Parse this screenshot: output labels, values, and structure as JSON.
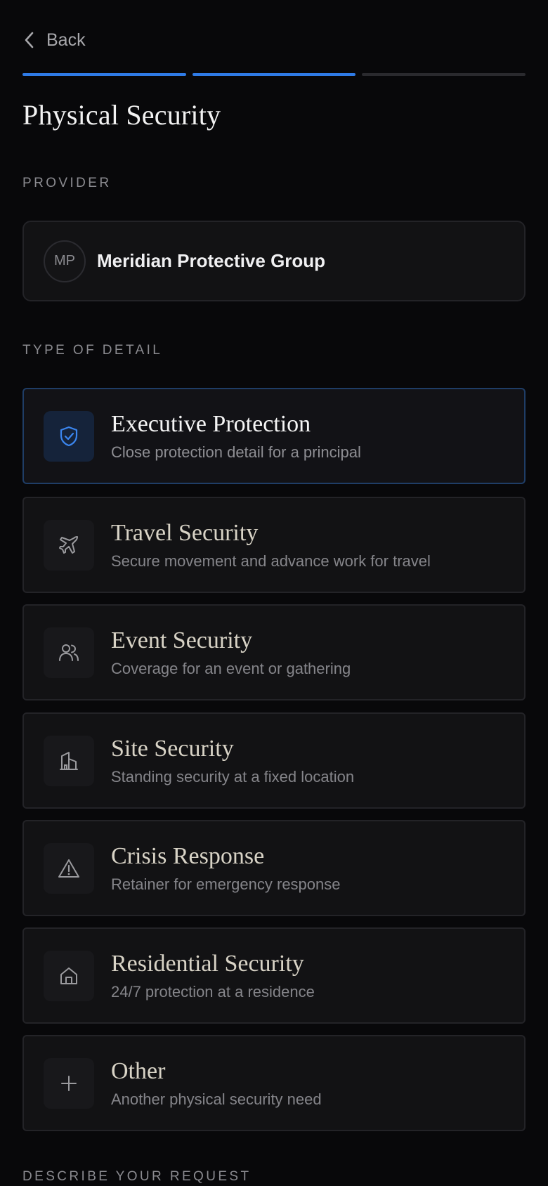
{
  "nav": {
    "back_label": "Back"
  },
  "progress": {
    "steps_total": 3,
    "steps_completed": 2,
    "accent_color": "#2f7be6"
  },
  "page": {
    "title": "Physical Security"
  },
  "provider": {
    "section_label": "PROVIDER",
    "initials": "MP",
    "name": "Meridian Protective Group"
  },
  "detail_types": {
    "section_label": "TYPE OF DETAIL",
    "selected": "Executive Protection",
    "options": [
      {
        "name": "Executive Protection",
        "desc": "Close protection detail for a principal",
        "icon": "shield-check-icon"
      },
      {
        "name": "Travel Security",
        "desc": "Secure movement and advance work for travel",
        "icon": "plane-icon"
      },
      {
        "name": "Event Security",
        "desc": "Coverage for an event or gathering",
        "icon": "users-icon"
      },
      {
        "name": "Site Security",
        "desc": "Standing security at a fixed location",
        "icon": "building-icon"
      },
      {
        "name": "Crisis Response",
        "desc": "Retainer for emergency response",
        "icon": "alert-triangle-icon"
      },
      {
        "name": "Residential Security",
        "desc": "24/7 protection at a residence",
        "icon": "home-icon"
      },
      {
        "name": "Other",
        "desc": "Another physical security need",
        "icon": "plus-icon"
      }
    ]
  },
  "request": {
    "section_label": "DESCRIBE YOUR REQUEST"
  }
}
